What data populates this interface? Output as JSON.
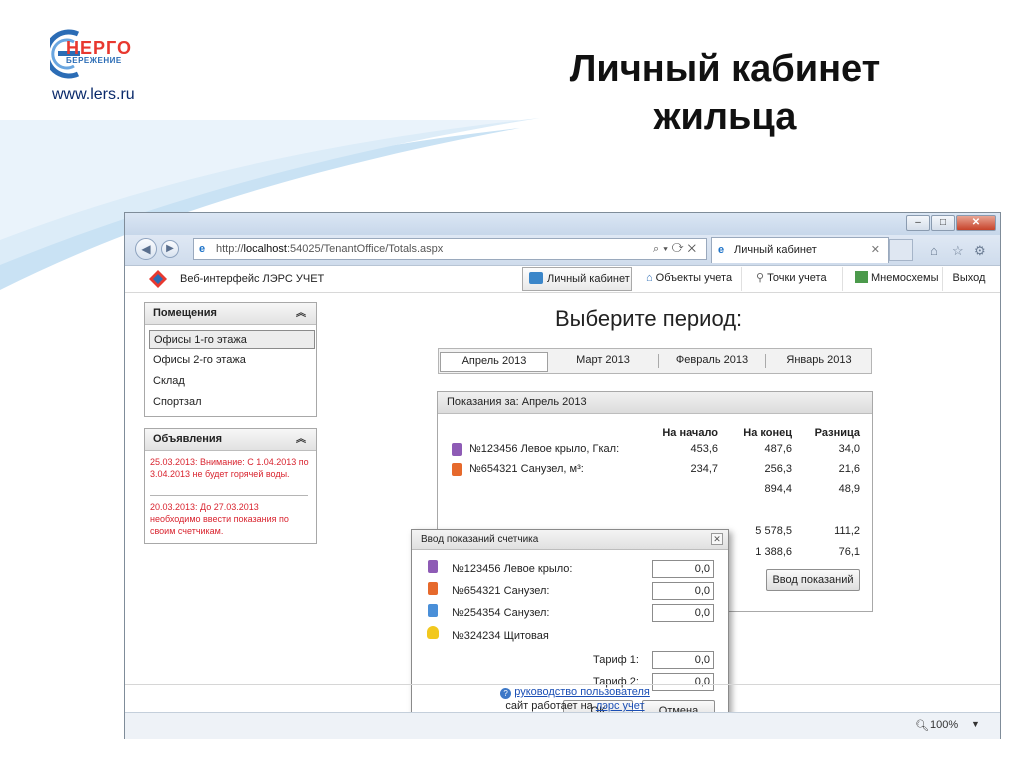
{
  "slide": {
    "site_url": "www.lers.ru",
    "title_line1": "Личный кабинет",
    "title_line2": "жильца",
    "logo_line1": "НЕРГО",
    "logo_line2": "БЕРЕЖЕНИЕ"
  },
  "browser": {
    "address_prefix": "http://",
    "address_host": "localhost",
    "address_rest": ":54025/TenantOffice/Totals.aspx",
    "tab_title": "Личный кабинет",
    "zoom": "100%"
  },
  "app": {
    "title": "Веб-интерфейс ЛЭРС УЧЕТ",
    "nav": [
      {
        "label": "Личный кабинет"
      },
      {
        "label": "Объекты учета"
      },
      {
        "label": "Точки учета"
      },
      {
        "label": "Мнемосхемы"
      },
      {
        "label": "Выход"
      }
    ]
  },
  "rooms": {
    "title": "Помещения",
    "items": [
      "Офисы 1-го этажа",
      "Офисы 2-го этажа",
      "Склад",
      "Спортзал"
    ]
  },
  "news": {
    "title": "Объявления",
    "items": [
      "25.03.2013:   Внимание: С 1.04.2013 по 3.04.2013 не будет горячей воды.",
      "20.03.2013:   До 27.03.2013 необходимо ввести показания по своим счетчикам."
    ]
  },
  "period": {
    "title": "Выберите период:",
    "tabs": [
      "Апрель 2013",
      "Март 2013",
      "Февраль 2013",
      "Январь 2013"
    ]
  },
  "readings": {
    "header": "Показания за: Апрель 2013",
    "col_start": "На начало",
    "col_end": "На конец",
    "col_diff": "Разница",
    "rows": [
      {
        "name": "№123456 Левое крыло, Гкал:",
        "start": "453,6",
        "end": "487,6",
        "diff": "34,0"
      },
      {
        "name": "№654321 Санузел, м³:",
        "start": "234,7",
        "end": "256,3",
        "diff": "21,6"
      },
      {
        "name": "",
        "start": "",
        "end": "894,4",
        "diff": "48,9"
      },
      {
        "name": "",
        "start": "",
        "end": "5 578,5",
        "diff": "111,2"
      },
      {
        "name": "",
        "start": "",
        "end": "1 388,6",
        "diff": "76,1"
      }
    ],
    "enter_button": "Ввод показаний"
  },
  "dialog": {
    "title": "Ввод показаний счетчика",
    "close": "✕",
    "meters": [
      {
        "label": "№123456 Левое крыло:",
        "value": "0,0",
        "color": "#8e5bb5"
      },
      {
        "label": "№654321 Санузел:",
        "value": "0,0",
        "color": "#e6692c"
      },
      {
        "label": "№254354 Санузел:",
        "value": "0,0",
        "color": "#4a8fd8"
      },
      {
        "label": "№324234 Щитовая",
        "value": "",
        "color": "#f2c81e"
      }
    ],
    "tariff1_label": "Тариф 1:",
    "tariff1_value": "0,0",
    "tariff2_label": "Тариф 2:",
    "tariff2_value": "0,0",
    "ok": "ОК",
    "cancel": "Отмена"
  },
  "footer": {
    "help_link": "руководство пользователя",
    "powered_prefix": "сайт работает на ",
    "powered_link": "лэрс учет"
  }
}
